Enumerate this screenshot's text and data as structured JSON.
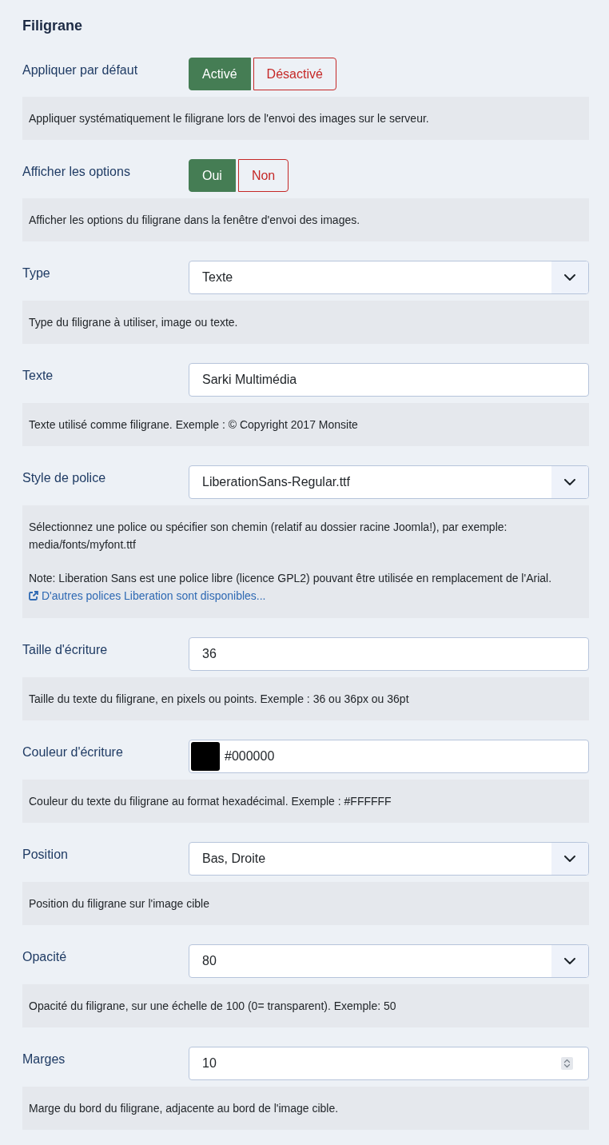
{
  "section": {
    "title": "Filigrane"
  },
  "fields": [
    {
      "kind": "toggle",
      "label": "Appliquer par défaut",
      "options": [
        {
          "label": "Activé",
          "selected": true,
          "color": "#457d54"
        },
        {
          "label": "Désactivé",
          "selected": false,
          "color": "#c52827"
        }
      ],
      "description": [
        "Appliquer systématiquement le filigrane lors de l'envoi des images sur le serveur."
      ]
    },
    {
      "kind": "toggle",
      "label": "Afficher les options",
      "options": [
        {
          "label": "Oui",
          "selected": true,
          "color": "#457d54"
        },
        {
          "label": "Non",
          "selected": false,
          "color": "#c52827"
        }
      ],
      "description": [
        "Afficher les options du filigrane dans la fenêtre d'envoi des images."
      ]
    },
    {
      "kind": "select",
      "label": "Type",
      "value": "Texte",
      "description": [
        "Type du filigrane à utiliser, image ou texte."
      ]
    },
    {
      "kind": "text",
      "label": "Texte",
      "value": "Sarki Multimédia",
      "description": [
        "Texte utilisé comme filigrane. Exemple : © Copyright 2017 Monsite"
      ]
    },
    {
      "kind": "select",
      "label": "Style de police",
      "value": "LiberationSans-Regular.ttf",
      "description": [
        "Sélectionnez une police ou spécifier son chemin (relatif au dossier racine Joomla!), par exemple: media/fonts/myfont.ttf",
        "Note: Liberation Sans est une police libre (licence GPL2) pouvant être utilisée en remplacement de l'Arial."
      ],
      "link": "D'autres polices Liberation sont disponibles..."
    },
    {
      "kind": "text",
      "label": "Taille d'écriture",
      "value": "36",
      "description": [
        "Taille du texte du filigrane, en pixels ou points. Exemple : 36 ou 36px ou 36pt"
      ]
    },
    {
      "kind": "color",
      "label": "Couleur d'écriture",
      "value": "#000000",
      "color": "#000000",
      "description": [
        "Couleur du texte du filigrane au format hexadécimal. Exemple : #FFFFFF"
      ]
    },
    {
      "kind": "select",
      "label": "Position",
      "value": "Bas, Droite",
      "description": [
        "Position du filigrane sur l'image cible"
      ]
    },
    {
      "kind": "select",
      "label": "Opacité",
      "value": "80",
      "description": [
        "Opacité du filigrane, sur une échelle de 100 (0= transparent). Exemple: 50"
      ]
    },
    {
      "kind": "number",
      "label": "Marges",
      "value": "10",
      "description": [
        "Marge du bord du filigrane, adjacente au bord de l'image cible."
      ]
    }
  ]
}
